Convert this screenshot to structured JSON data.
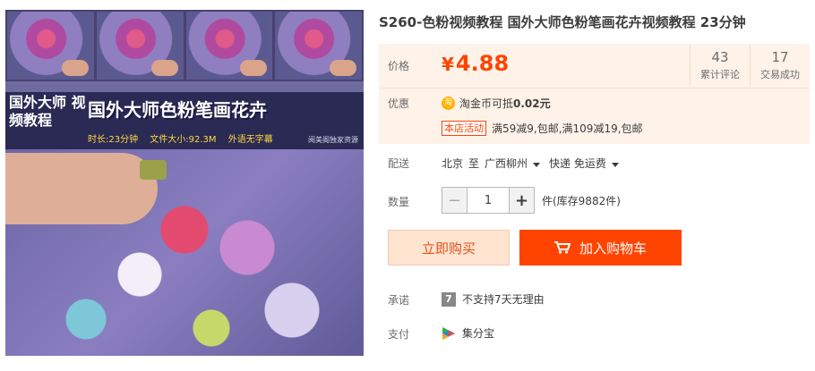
{
  "product": {
    "title": "S260-色粉视频教程 国外大师色粉笔画花卉视频教程 23分钟"
  },
  "image": {
    "banner_left": "国外大师 视频教程",
    "banner_title": "国外大师色粉笔画花卉",
    "meta_duration": "时长:23分钟",
    "meta_size": "文件大小:92.3M",
    "meta_subs": "外语无字幕",
    "credit": "阅美阁独家资源"
  },
  "price": {
    "label": "价格",
    "currency": "¥",
    "value": "4.88"
  },
  "stats": {
    "reviews_count": "43",
    "reviews_label": "累计评论",
    "deals_count": "17",
    "deals_label": "交易成功"
  },
  "discount": {
    "label": "优惠",
    "coin_icon": "淘",
    "coin_text": "淘金币可抵",
    "coin_value": "0.02元",
    "promo_badge": "本店活动",
    "promo_text": "满59减9,包邮,满109减19,包邮"
  },
  "shipping": {
    "label": "配送",
    "from": "北京",
    "to_word": "至",
    "destination": "广西柳州",
    "method": "快递 免运费"
  },
  "quantity": {
    "label": "数量",
    "minus": "−",
    "value": "1",
    "plus": "+",
    "stock": "件(库存9882件)"
  },
  "actions": {
    "buy_now": "立即购买",
    "add_to_cart": "加入购物车"
  },
  "promise": {
    "label": "承诺",
    "icon_text": "7",
    "text": "不支持7天无理由"
  },
  "payment": {
    "label": "支付",
    "text": "集分宝"
  },
  "colors": {
    "accent": "#ff4400",
    "price": "#ff4400",
    "panel_bg": "#fff2e8",
    "buy_bg": "#ffe4d0"
  }
}
